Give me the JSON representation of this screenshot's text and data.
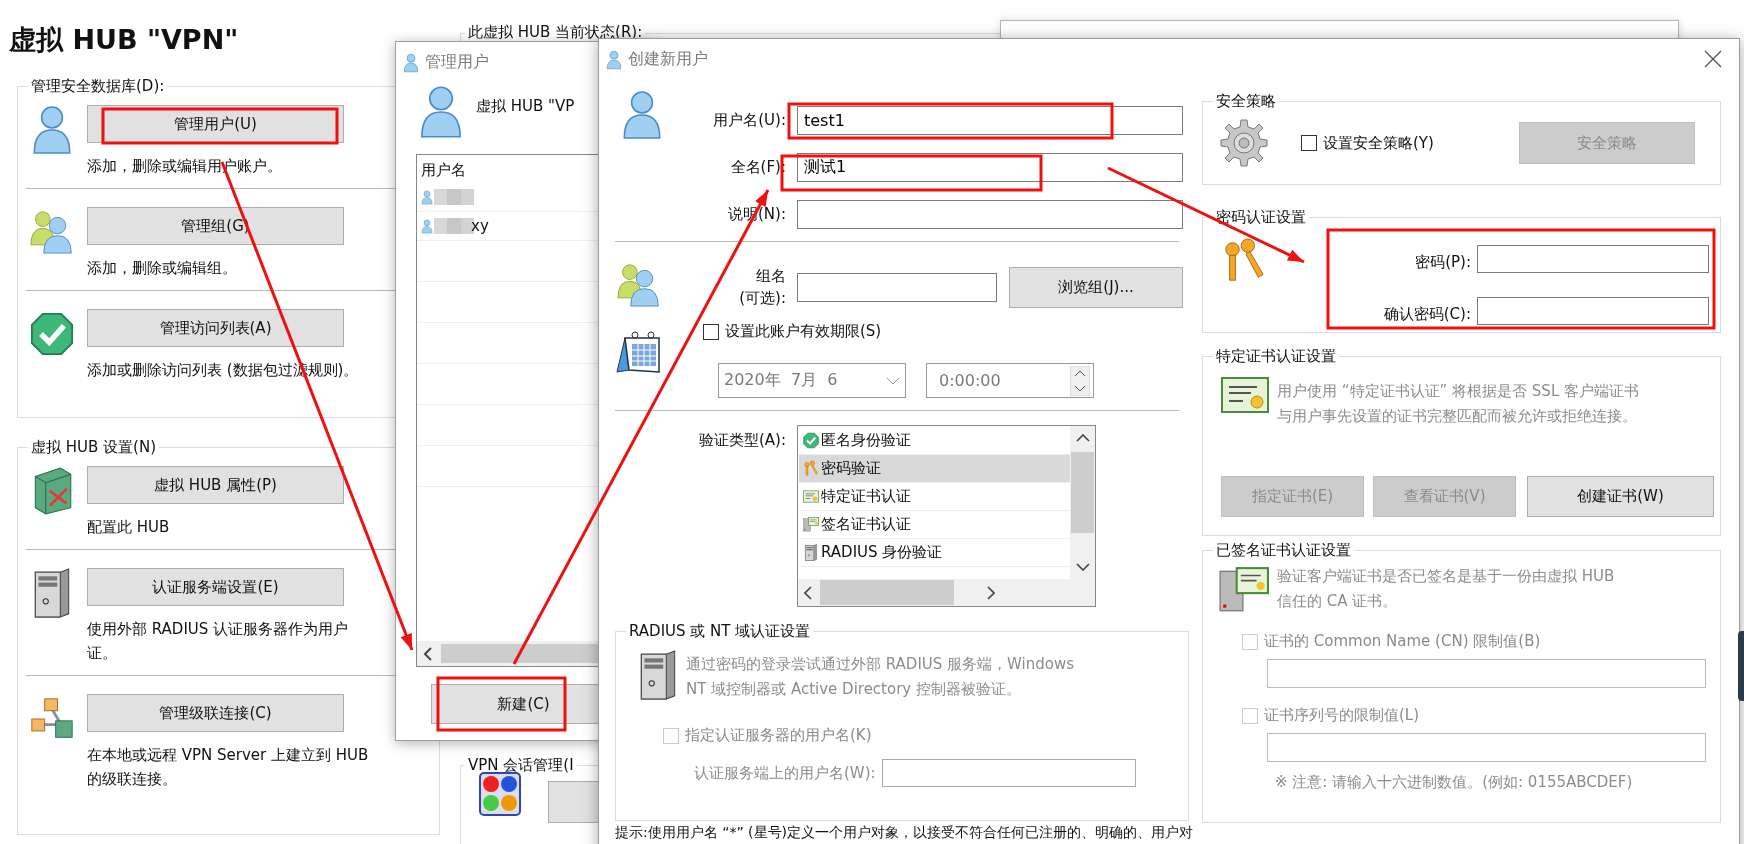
{
  "main_window": {
    "title": "虚拟 HUB \"VPN\"",
    "groups": [
      {
        "label": "管理安全数据库(D):",
        "items": [
          {
            "kind": "user",
            "button": "管理用户(U)",
            "description": [
              "添加，删除或编辑用户账户。"
            ]
          },
          {
            "kind": "group",
            "button": "管理组(G)",
            "description": [
              "添加，删除或编辑组。"
            ]
          },
          {
            "kind": "check",
            "button": "管理访问列表(A)",
            "description": [
              "添加或删除访问列表 (数据包过滤规则)。"
            ]
          }
        ]
      },
      {
        "label": "虚拟 HUB 设置(N)",
        "items": [
          {
            "kind": "hub",
            "button": "虚拟 HUB 属性(P)",
            "description": [
              "配置此 HUB"
            ]
          },
          {
            "kind": "server",
            "button": "认证服务端设置(E)",
            "description": [
              "使用外部 RADIUS 认证服务器作为用户",
              "证。"
            ]
          },
          {
            "kind": "cascade",
            "button": "管理级联连接(C)",
            "description": [
              "在本地或远程 VPN Server 上建立到 HUB",
              "的级联连接。"
            ]
          }
        ]
      }
    ],
    "status_label": "此虚拟 HUB 当前状态(R):",
    "session_label": "VPN 会话管理(I"
  },
  "manage_users": {
    "title": "管理用户",
    "hub_label": "虚拟 HUB \"VP",
    "column": "用户名",
    "rows": [
      {
        "kind": "blurred"
      },
      {
        "kind": "blurred",
        "name_tail": "xy"
      }
    ],
    "new_button": "新建(C)"
  },
  "create_user": {
    "title": "创建新用户",
    "fields": [
      {
        "label": "用户名(U):",
        "value": "test1"
      },
      {
        "label": "全名(F):",
        "value": "测试1"
      },
      {
        "label": "说明(N):"
      }
    ],
    "group": {
      "label_lines": [
        "组名",
        "(可选):"
      ],
      "browse_button": "浏览组(J)..."
    },
    "expiry": {
      "label": "设置此账户有效期限(S)",
      "checked": false,
      "date": "2020年  7月  6",
      "time": "0:00:00",
      "disabled": true
    },
    "auth_type": {
      "label": "验证类型(A):",
      "options": [
        {
          "kind": "check",
          "label": "匿名身份验证",
          "selected": false
        },
        {
          "kind": "keys",
          "label": "密码验证",
          "selected": true
        },
        {
          "kind": "cert",
          "label": "特定证书认证",
          "selected": false
        },
        {
          "kind": "signed",
          "label": "签名证书认证",
          "selected": false
        },
        {
          "kind": "server",
          "label": "RADIUS 身份验证",
          "selected": false
        }
      ]
    },
    "radius": {
      "title": "RADIUS 或 NT 域认证设置",
      "description": [
        "通过密码的登录尝试通过外部 RADIUS 服务端，Windows",
        "NT 域控制器或 Active Directory 控制器被验证。"
      ],
      "checkbox": {
        "label": "指定认证服务器的用户名(K)",
        "checked": false,
        "disabled": true
      },
      "username_label": "认证服务端上的用户名(W):"
    },
    "hint": "提示:使用用户名 “*” (星号)定义一个用户对象，以接受不符合任何已注册的、明确的、用户对",
    "security": {
      "title": "安全策略",
      "checkbox": {
        "label": "设置安全策略(Y)",
        "checked": false
      },
      "button": {
        "label": "安全策略",
        "disabled": true
      }
    },
    "password": {
      "title": "密码认证设置",
      "fields": [
        {
          "label": "密码(P):"
        },
        {
          "label": "确认密码(C):"
        }
      ]
    },
    "cert": {
      "title": "特定证书认证设置",
      "description": [
        "用户使用 “特定证书认证” 将根据是否 SSL 客户端证书",
        "与用户事先设置的证书完整匹配而被允许或拒绝连接。"
      ],
      "buttons": [
        {
          "label": "指定证书(E)",
          "disabled": true
        },
        {
          "label": "查看证书(V)",
          "disabled": true
        },
        {
          "label": "创建证书(W)",
          "disabled": false
        }
      ]
    },
    "signed": {
      "title": "已签名证书认证设置",
      "description": [
        "验证客户端证书是否已签名是基于一份由虚拟 HUB",
        "信任的 CA 证书。"
      ],
      "restrictions": [
        {
          "label": "证书的 Common Name (CN) 限制值(B)",
          "checked": false,
          "disabled": true
        },
        {
          "label": "证书序列号的限制值(L)",
          "checked": false,
          "disabled": true
        }
      ],
      "note": "※ 注意: 请输入十六进制数值。(例如: 0155ABCDEF)"
    }
  }
}
